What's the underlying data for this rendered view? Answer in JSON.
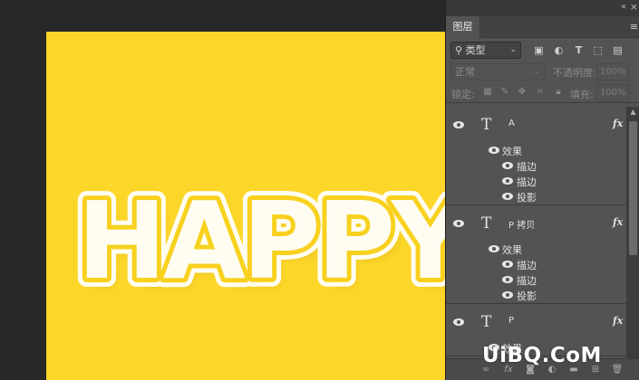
{
  "canvas": {
    "art_text": "HAPPY",
    "background_color": "#fdd62a",
    "fill_color": "#fffdf2",
    "stroke_color": "#f8d11f"
  },
  "panel": {
    "tab_label": "图层",
    "filter": {
      "label": "类型"
    },
    "blend_mode": "正常",
    "opacity_label": "不透明度:",
    "opacity_value": "100%",
    "lock_label": "锁定:",
    "fill_label": "填充:",
    "fill_value": "100%",
    "layers": [
      {
        "name": "A",
        "effects_label": "效果",
        "effects": [
          "描边",
          "描边",
          "投影"
        ]
      },
      {
        "name": "P 拷贝",
        "effects_label": "效果",
        "effects": [
          "描边",
          "描边",
          "投影"
        ]
      },
      {
        "name": "P",
        "effects_label": "效果",
        "effects": []
      }
    ]
  },
  "icons": {
    "collapse": "double-chevron-icon",
    "close": "close-icon",
    "menu": "panel-menu-icon",
    "visibility": "eye-icon",
    "layer_type": "text-layer-icon",
    "effects": "fx-icon"
  },
  "watermark": "UiBQ.CoM"
}
